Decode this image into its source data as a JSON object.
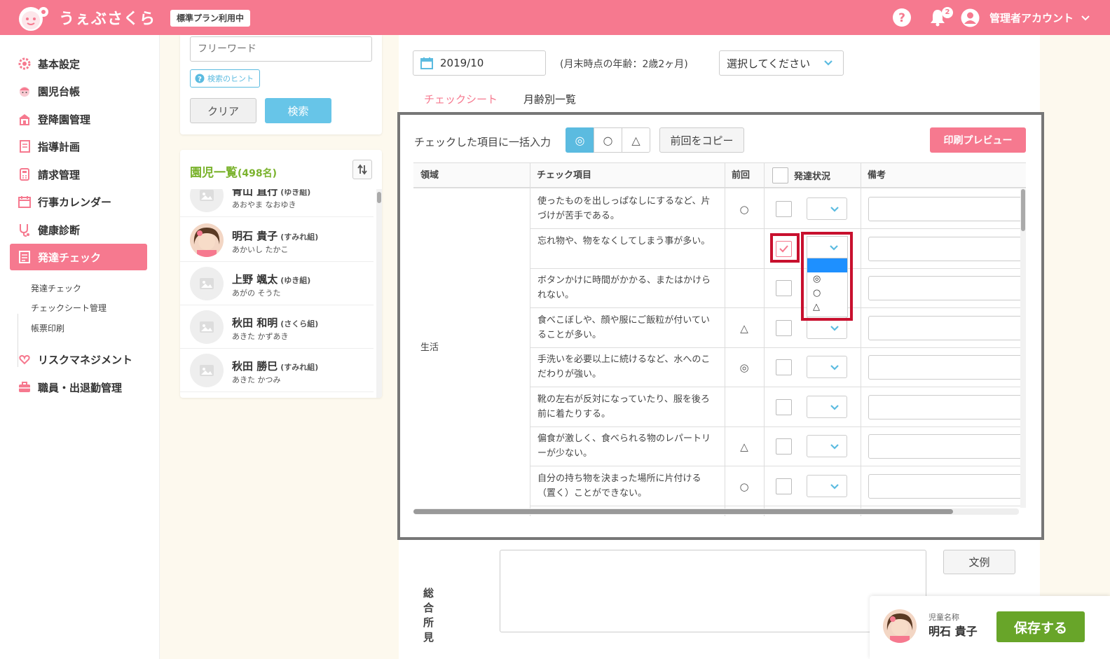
{
  "app": {
    "name": "うぇぶさくら",
    "plan_badge": "標準プラン利用中",
    "notification_count": "2",
    "account_label": "管理者アカウント"
  },
  "sidebar": {
    "items": [
      {
        "label": "基本設定",
        "icon": "gear-icon"
      },
      {
        "label": "園児台帳",
        "icon": "child-icon"
      },
      {
        "label": "登降園管理",
        "icon": "building-icon"
      },
      {
        "label": "指導計画",
        "icon": "notebook-icon"
      },
      {
        "label": "請求管理",
        "icon": "calculator-icon"
      },
      {
        "label": "行事カレンダー",
        "icon": "calendar-icon"
      },
      {
        "label": "健康診断",
        "icon": "stethoscope-icon"
      },
      {
        "label": "発達チェック",
        "icon": "checklist-icon"
      },
      {
        "label": "リスクマネジメント",
        "icon": "heart-hands-icon"
      },
      {
        "label": "職員・出退勤管理",
        "icon": "briefcase-icon"
      }
    ],
    "subitems": [
      "発達チェック",
      "チェックシート管理",
      "帳票印刷"
    ]
  },
  "search": {
    "placeholder": "フリーワード",
    "hint_label": "検索のヒント",
    "clear_label": "クリア",
    "search_label": "検索"
  },
  "kids": {
    "title": "園児一覧",
    "count": "(498名)",
    "list": [
      {
        "name": "青山 直行",
        "class": "(ゆき組)",
        "kana": "あおやま なおゆき"
      },
      {
        "name": "明石 貴子",
        "class": "(すみれ組)",
        "kana": "あかいし たかこ"
      },
      {
        "name": "上野 颯太",
        "class": "(ゆき組)",
        "kana": "あがの そうた"
      },
      {
        "name": "秋田 和明",
        "class": "(さくら組)",
        "kana": "あきた かずあき"
      },
      {
        "name": "秋田 勝巳",
        "class": "(すみれ組)",
        "kana": "あきた かつみ"
      }
    ]
  },
  "main": {
    "date": "2019/10",
    "age_text": "(月末時点の年齢：2歳2ヶ月)",
    "select_placeholder": "選択してください",
    "tabs": [
      "チェックシート",
      "月齢別一覧"
    ],
    "bulk_label": "チェックした項目に一括入力",
    "marks": [
      "◎",
      "○",
      "△"
    ],
    "copy_label": "前回をコピー",
    "print_label": "印刷プレビュー",
    "headers": {
      "domain": "領域",
      "item": "チェック項目",
      "prev": "前回",
      "status": "発達状況",
      "note": "備考"
    },
    "domain_value": "生活",
    "rows": [
      {
        "text": "使ったものを出しっぱなしにするなど、片づけが苦手である。",
        "prev": "○"
      },
      {
        "text": "忘れ物や、物をなくしてしまう事が多い。",
        "prev": ""
      },
      {
        "text": "ボタンかけに時間がかかる、またはかけられない。",
        "prev": ""
      },
      {
        "text": "食べこぼしや、顔や服にご飯粒が付いていることが多い。",
        "prev": "△"
      },
      {
        "text": "手洗いを必要以上に続けるなど、水へのこだわりが強い。",
        "prev": "◎"
      },
      {
        "text": "靴の左右が反対になっていたり、服を後ろ前に着たりする。",
        "prev": ""
      },
      {
        "text": "偏食が激しく、食べられる物のレパートリーが少ない。",
        "prev": "△"
      },
      {
        "text": "自分の持ち物を決まった場所に片付ける（置く）ことができない。",
        "prev": "○"
      }
    ],
    "dropdown_options": [
      "",
      "◎",
      "○",
      "△"
    ],
    "sogo_label": "総合所見",
    "bunrei_label": "文例"
  },
  "save_bar": {
    "label": "児童名称",
    "name": "明石 貴子",
    "button": "保存する"
  },
  "colors": {
    "brand": "#f6798f",
    "accent_blue": "#5bbbe0",
    "kids_title": "#7bb32e",
    "save_green": "#68a529",
    "highlight_red": "#c8102e"
  }
}
